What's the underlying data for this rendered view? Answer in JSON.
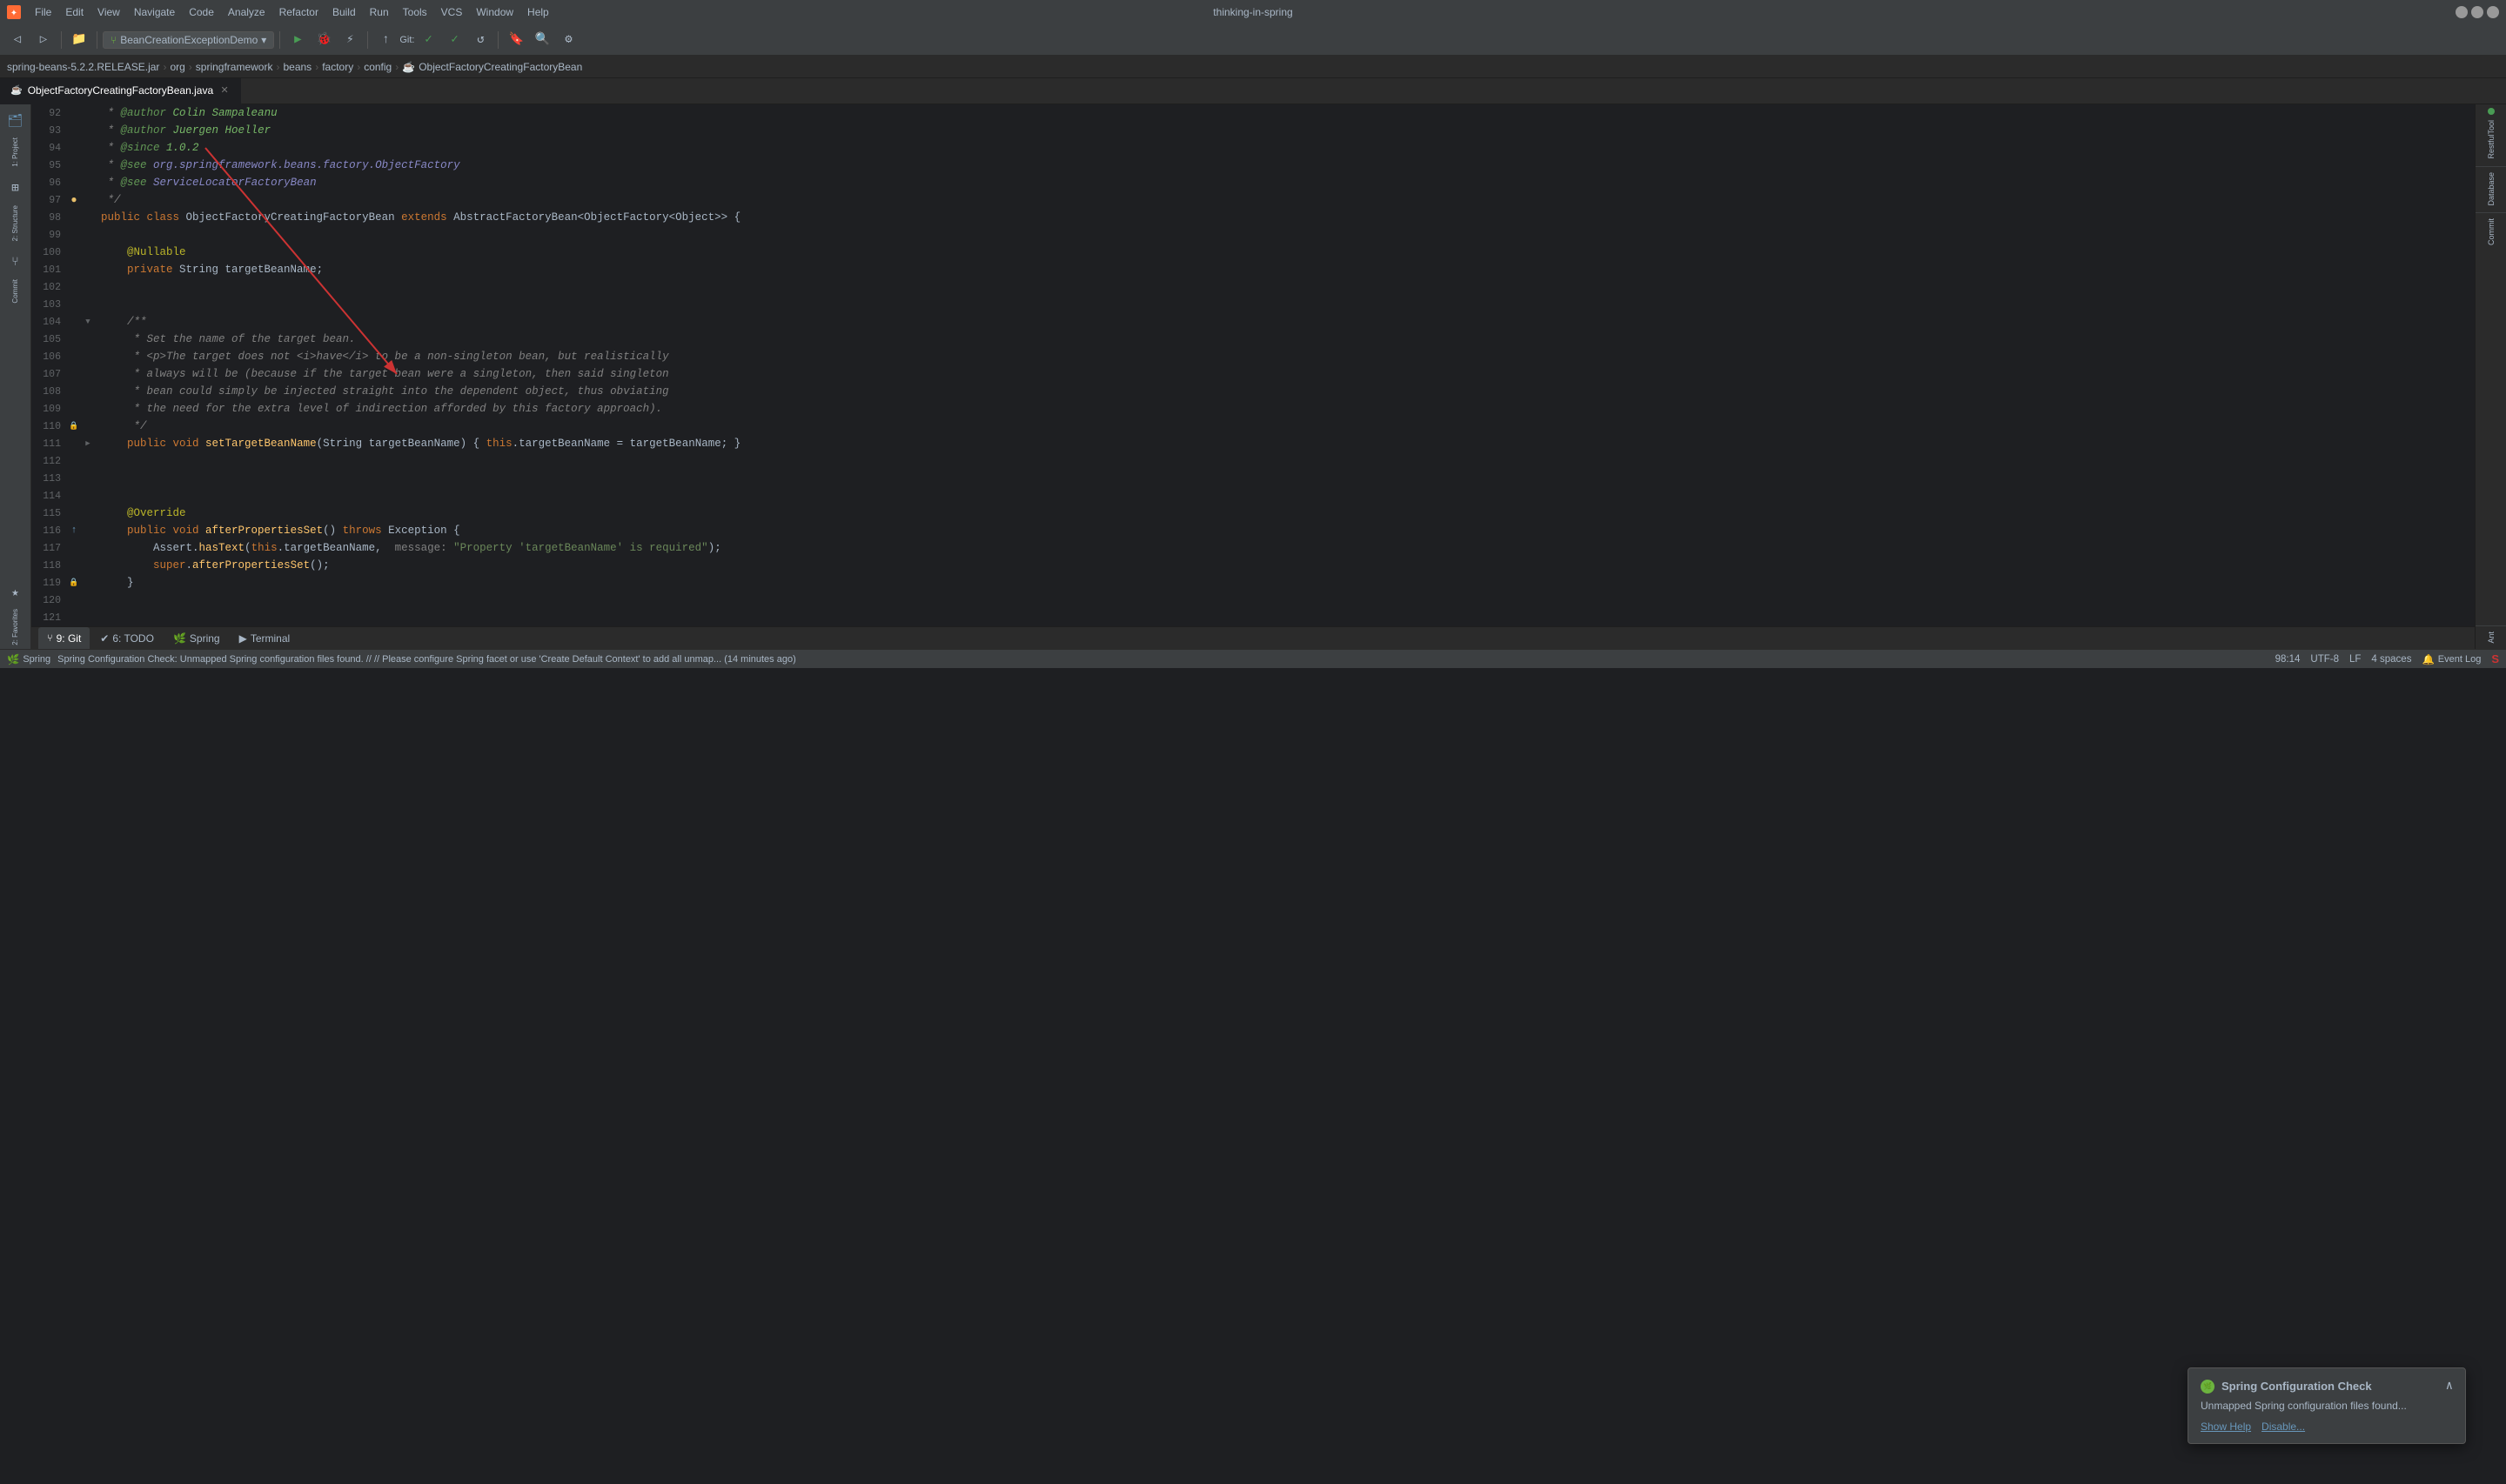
{
  "window": {
    "title": "thinking-in-spring",
    "controls": {
      "minimize": "─",
      "maximize": "□",
      "close": "✕"
    }
  },
  "menu": {
    "items": [
      "File",
      "Edit",
      "View",
      "Navigate",
      "Code",
      "Analyze",
      "Refactor",
      "Build",
      "Run",
      "Tools",
      "VCS",
      "Window",
      "Help"
    ]
  },
  "breadcrumb": {
    "items": [
      "spring-beans-5.2.2.RELEASE.jar",
      "org",
      "springframework",
      "beans",
      "factory",
      "config"
    ],
    "current": "ObjectFactoryCreatingFactoryBean"
  },
  "toolbar": {
    "branch": "BeanCreationExceptionDemo",
    "git_label": "Git:"
  },
  "tab": {
    "filename": "ObjectFactoryCreatingFactoryBean.java",
    "icon": "☕"
  },
  "notification": {
    "title": "Spring Configuration Check",
    "body": "Unmapped Spring configuration files found...",
    "show_help": "Show Help",
    "disable": "Disable...",
    "icon_color": "#6cb33f"
  },
  "status_bar": {
    "message": "Spring Configuration Check: Unmapped Spring configuration files found. // // Please configure Spring facet or use 'Create Default Context' to add all unmap... (14 minutes ago)",
    "git": "9: Git",
    "todo": "6: TODO",
    "spring": "Spring",
    "terminal": "Terminal",
    "position": "98:14",
    "encoding": "UTF-8",
    "line_sep": "LF",
    "indent": "4 spaces"
  },
  "right_sidebar": {
    "items": [
      "RestfulTool",
      "Database",
      "Commit",
      "Structure",
      "Project",
      "Ant"
    ]
  },
  "code_lines": [
    {
      "num": 92,
      "content": " * @author Colin Sampaleanu",
      "type": "javadoc"
    },
    {
      "num": 93,
      "content": " * @author Juergen Hoeller",
      "type": "javadoc"
    },
    {
      "num": 94,
      "content": " * @since 1.0.2",
      "type": "javadoc"
    },
    {
      "num": 95,
      "content": " * @see org.springframework.beans.factory.ObjectFactory",
      "type": "javadoc"
    },
    {
      "num": 96,
      "content": " * @see ServiceLocatorFactoryBean",
      "type": "javadoc"
    },
    {
      "num": 97,
      "content": " */",
      "type": "comment_end"
    },
    {
      "num": 98,
      "content": "public class ObjectFactoryCreatingFactoryBean extends AbstractFactoryBean<ObjectFactory<Object>> {",
      "type": "class_decl"
    },
    {
      "num": 99,
      "content": "",
      "type": "empty"
    },
    {
      "num": 100,
      "content": "    @Nullable",
      "type": "annotation"
    },
    {
      "num": 101,
      "content": "    private String targetBeanName;",
      "type": "field"
    },
    {
      "num": 102,
      "content": "",
      "type": "empty"
    },
    {
      "num": 103,
      "content": "",
      "type": "empty"
    },
    {
      "num": 104,
      "content": "    /**",
      "type": "javadoc_start",
      "gutter": "fold"
    },
    {
      "num": 105,
      "content": "     * Set the name of the target bean.",
      "type": "javadoc"
    },
    {
      "num": 106,
      "content": "     * <p>The target does not <i>have</i> to be a non-singleton bean, but realistically",
      "type": "javadoc"
    },
    {
      "num": 107,
      "content": "     * always will be (because if the target bean were a singleton, then said singleton",
      "type": "javadoc"
    },
    {
      "num": 108,
      "content": "     * bean could simply be injected straight into the dependent object, thus obviating",
      "type": "javadoc"
    },
    {
      "num": 109,
      "content": "     * the need for the extra level of indirection afforded by this factory approach).",
      "type": "javadoc"
    },
    {
      "num": 110,
      "content": "     */",
      "type": "comment_end",
      "gutter": "lock"
    },
    {
      "num": 111,
      "content": "    public void setTargetBeanName(String targetBeanName) { this.targetBeanName = targetBeanName; }",
      "type": "method",
      "gutter": "fold"
    },
    {
      "num": 112,
      "content": "",
      "type": "empty"
    },
    {
      "num": 113,
      "content": "",
      "type": "empty"
    },
    {
      "num": 114,
      "content": "",
      "type": "empty"
    },
    {
      "num": 115,
      "content": "    @Override",
      "type": "annotation"
    },
    {
      "num": 116,
      "content": "    public void afterPropertiesSet() throws Exception {",
      "type": "method_decl",
      "gutter": "blue_arrow"
    },
    {
      "num": 117,
      "content": "        Assert.hasText(this.targetBeanName,  message: \"Property 'targetBeanName' is required\");",
      "type": "code"
    },
    {
      "num": 118,
      "content": "        super.afterPropertiesSet();",
      "type": "code"
    },
    {
      "num": 119,
      "content": "    }",
      "type": "code",
      "gutter": "lock"
    },
    {
      "num": 120,
      "content": "",
      "type": "empty"
    },
    {
      "num": 121,
      "content": "",
      "type": "empty"
    }
  ]
}
